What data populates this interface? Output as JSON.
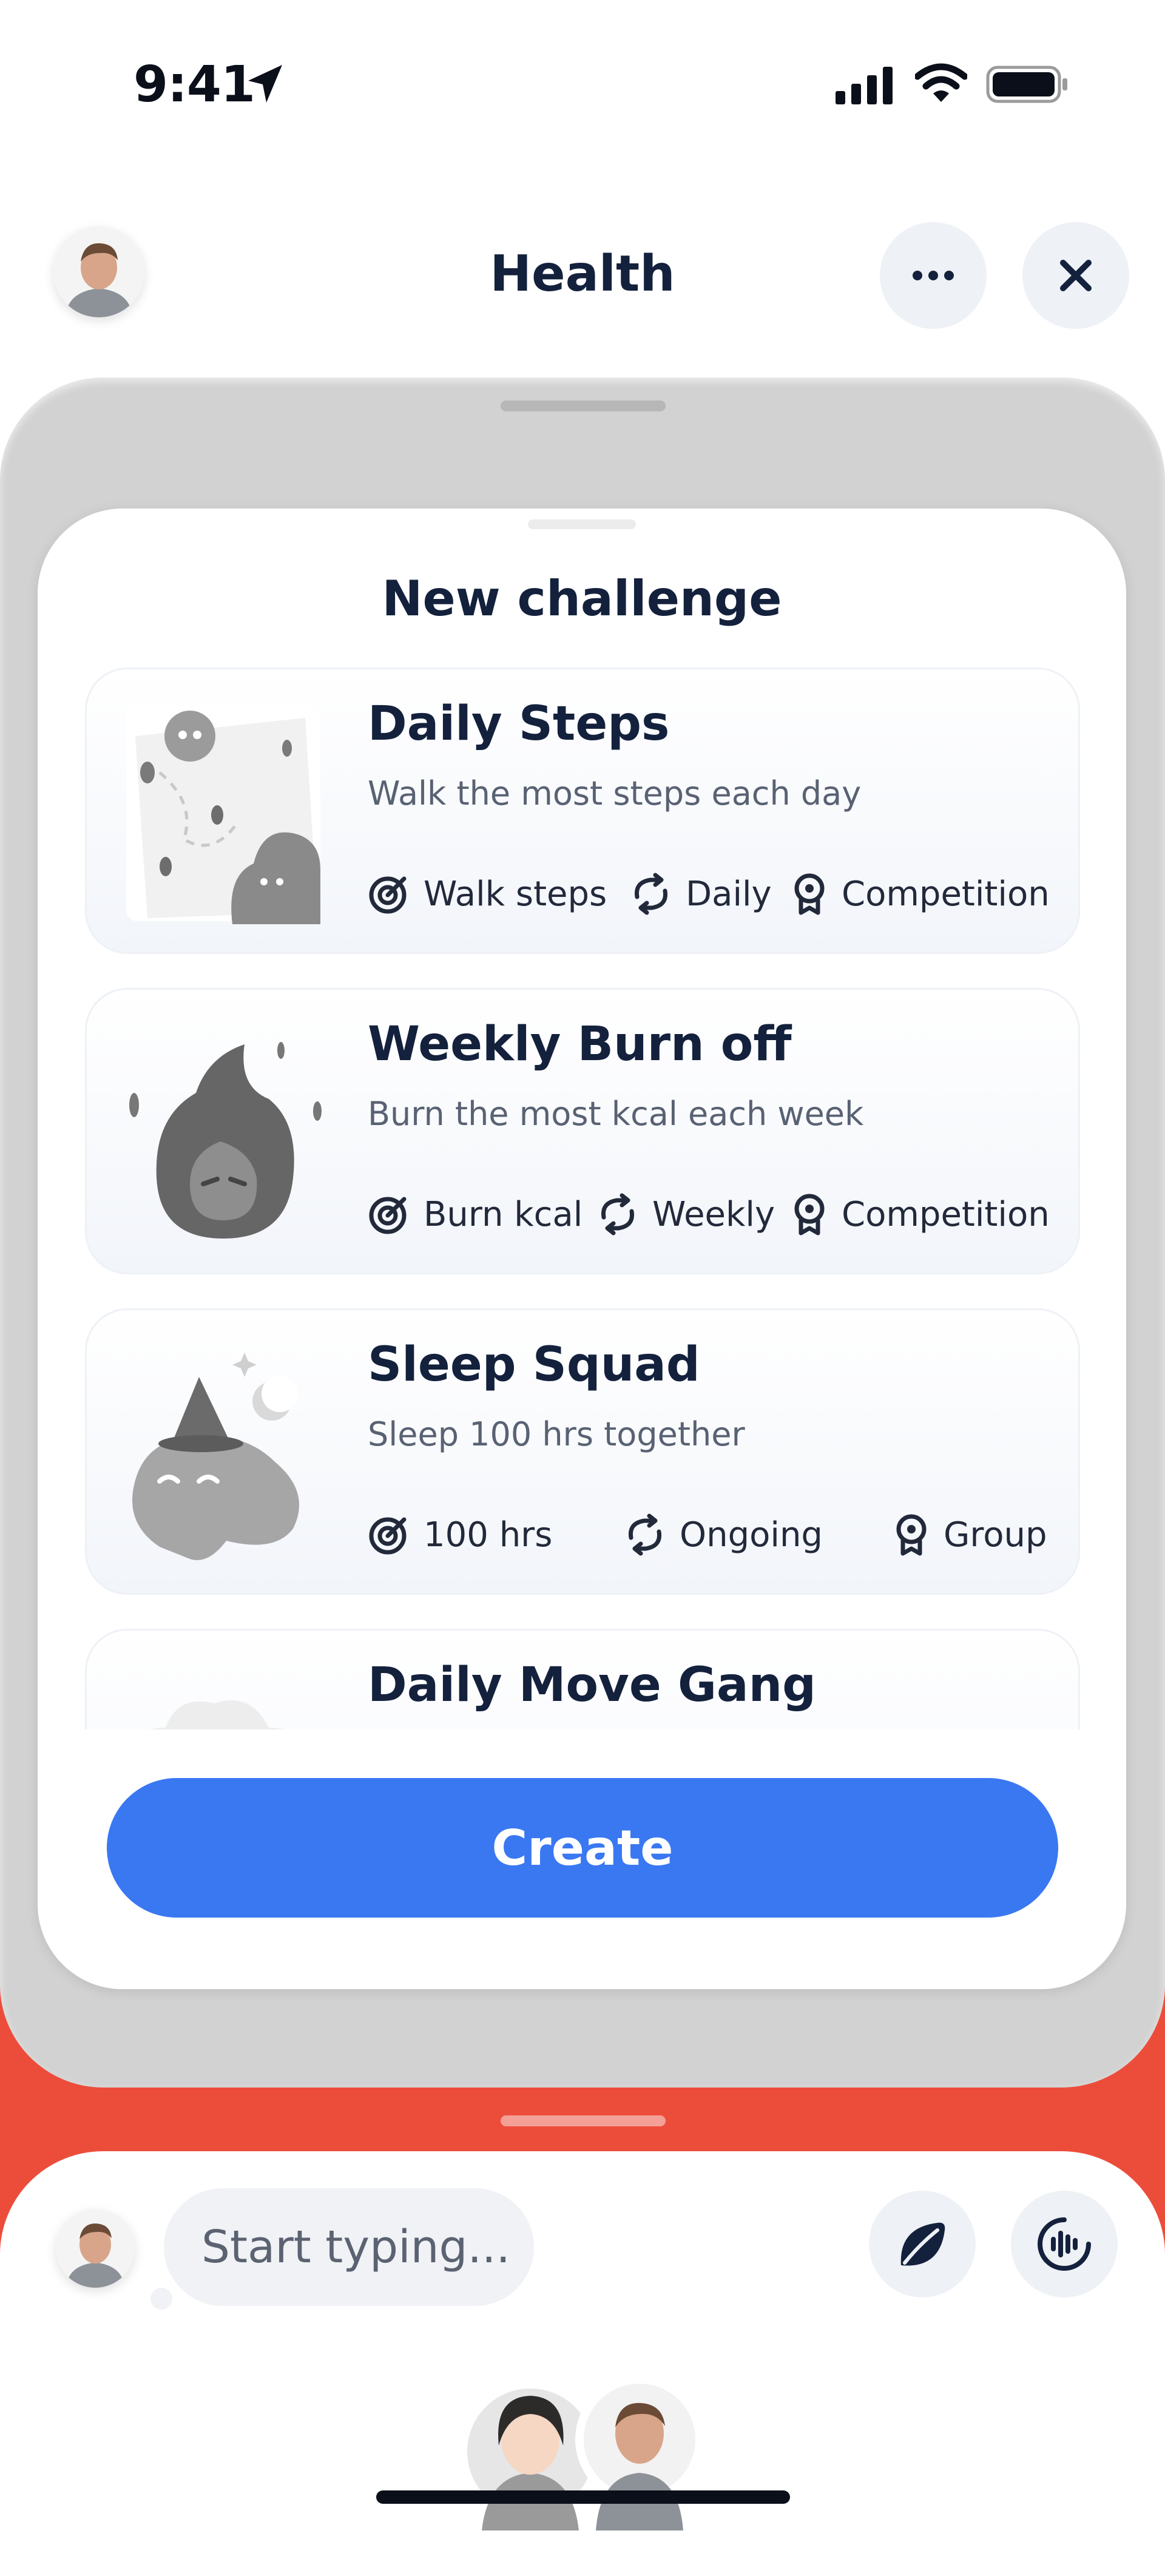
{
  "status_bar": {
    "time": "9:41"
  },
  "header": {
    "title": "Health"
  },
  "sheet": {
    "title": "New challenge",
    "challenges": [
      {
        "title": "Daily Steps",
        "subtitle": "Walk the most steps each day",
        "tags": [
          "Walk steps",
          "Daily",
          "Competition"
        ]
      },
      {
        "title": "Weekly Burn off",
        "subtitle": "Burn the most kcal each week",
        "tags": [
          "Burn kcal",
          "Weekly",
          "Competition"
        ]
      },
      {
        "title": "Sleep Squad",
        "subtitle": "Sleep 100 hrs together",
        "tags": [
          "100 hrs",
          "Ongoing",
          "Group"
        ]
      },
      {
        "title": "Daily Move Gang"
      }
    ],
    "create_label": "Create"
  },
  "composer": {
    "placeholder": "Start typing..."
  },
  "icons": {
    "location": "location-arrow-icon",
    "signal": "cellular-signal-icon",
    "wifi": "wifi-icon",
    "battery": "battery-icon",
    "more": "ellipsis-icon",
    "close": "close-icon",
    "goal": "target-icon",
    "repeat": "repeat-icon",
    "award": "award-badge-icon",
    "leaf": "leaf-icon",
    "voice": "voice-waveform-icon"
  },
  "colors": {
    "accent": "#3a78f2",
    "band": "#ec4d3b",
    "title": "#14213d"
  }
}
